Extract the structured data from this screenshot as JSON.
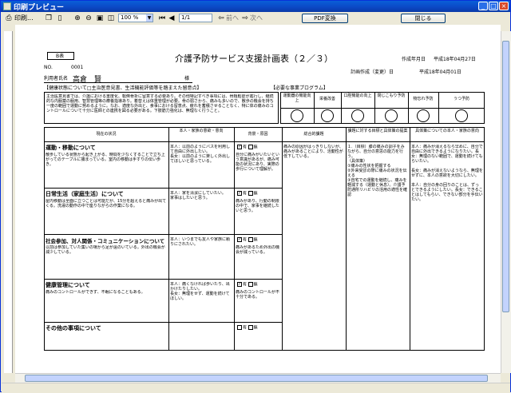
{
  "window": {
    "title": "印刷プレビュー"
  },
  "toolbar": {
    "print_label": "印刷...",
    "zoom_value": "100 %",
    "page_value": "1/1",
    "prev_label": "前へ",
    "next_label": "次へ",
    "pdf_label": "PDF変換",
    "close_label": "閉じる"
  },
  "doc": {
    "b_label": "B表",
    "no_label": "NO.",
    "no_value": "0001",
    "title": "介護予防サービス支援計画表（２／３）",
    "created_by_label": "作成年月日",
    "created_date": "平成18年04月27日",
    "user_label": "利用者氏名",
    "user_name": "高倉　賢",
    "sama": "様",
    "plan_label": "計画作成（変更）日",
    "plan_date": "平成18年04月01日",
    "doctor_heading": "【健康状態について□主治医意見書、生活機能評価等を踏まえた留意点】",
    "doctor_text": "主治医意見書では、介護における重度化、転倒骨折に留意する必要あり。その他特記すべき事項には、骨粗鬆症が進行し、継続的な内服薬の服用、智慧管理等の療養指導あり。着替えは体重管理が必要。骨の弱さから、痛みも多いので、散歩の機会を持ち一度の範囲で運動に努めるように。なお、適度な外出と、食事における留意点、疲れを蓄積させることなく、特に体の痛みのコントロールについて十分に医師との連携を図る必要がある。下肢筋力強化は、無理なく行うこと。",
    "program_heading": "【必要な事業プログラム】",
    "programs": [
      "運動器の機能向上",
      "栄養改善",
      "口腔機能の向上",
      "閉じこもり予防",
      "物忘れ予防",
      "うつ予防"
    ],
    "columns": [
      "現在の状況",
      "本人・家族の意欲・意向",
      "背景・原因",
      "総合的課題",
      "課題に対する目標と具体策の提案",
      "具体策についての本人・家族の意向"
    ],
    "rows": [
      {
        "title": "運動・移動について",
        "status": "散歩している状態から起き上がる、時間を少なくすることで立ち上がってのテーブルに捕まっている。室内の移動は手すりの伝い歩き。",
        "wish": "本人：以前のようにバスを利用して自由に外出したい。\n長女：以前のように楽しく外出してほしいと思っている。",
        "bg_yes": true,
        "bg_text": "自分に痛みがいたいという意識があるが、痛み可能の状況にあり、実際の歩行について理解が。"
      },
      {
        "title": "日常生活（家庭生活）について",
        "status": "屋内移動は全面に立つことは可能だが、15分を超えると痛みが出てくる。洗濯の動作の中で座りながらの作業になる。",
        "wish": "本人：家を清潔にしていたい。\n家事はしたいと思う。",
        "bg_yes": true,
        "bg_text": "痛みがあり、行動の制限の中で、家事を継続したいと思う。"
      },
      {
        "title": "社会参加、対人関係・コミュニケーションについて",
        "status": "以前は参加していた集いの場から足が遠のいている。外出の機会が減少している。",
        "wish": "本人：いつまでも友人や家族に頼りにされたい。",
        "bg_yes": true,
        "bg_text": "痛みがあるため外出の機会が減っている。"
      },
      {
        "title": "健康管理について",
        "status": "痛みのコントロールができず、不眠になることもある。",
        "wish": "本人：痛くなければ歩いたり、出かけたりしたい。\n長女：無理をせず、運動を続けてほしい。",
        "bg_yes": true,
        "bg_text": "痛みのコントロールが不十分である。"
      },
      {
        "title": "その他の事項について",
        "status": "",
        "wish": "",
        "bg_yes": false,
        "bg_text": ""
      }
    ],
    "bg_yes_label": "有",
    "bg_no_label": "無",
    "summary": "痛みの原因がはっきりしないが、痛みがあることにより、活動性が低下している。",
    "goal_text": "１.（目標）膝の痛みの調子をみながら、自分の意思の能力を行う。\n（具体策）\n①痛みの性状を把握する\n②外来受診の際に痛みの状況を伝える\n③自宅での運動を継続し、痛みを軽減する（運動と休息）。介護予防通所リハビリの活用の適性を確認",
    "intent_text": "本人：痛みが消えるなら早めに、自分で自由に外出できるようになりたい。長女：無理のない範囲で、運動を続けてもらいたい。\n\n長女：痛みが消えないようなら、無理をせずに、本人の意欲を大切にしたい。\n\n本人：自分の身の回りのことは、ずっとできるようにしたい。長女：できることはしてもらい、できない部分を手伝いたい。"
  }
}
